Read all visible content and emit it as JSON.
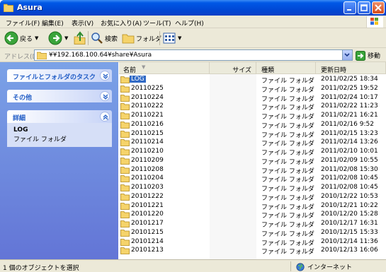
{
  "window": {
    "title": "Asura"
  },
  "menu": [
    "ファイル(F)",
    "編集(E)",
    "表示(V)",
    "お気に入り(A)",
    "ツール(T)",
    "ヘルプ(H)"
  ],
  "toolbar": {
    "back": "戻る",
    "search": "検索",
    "folders": "フォルダ"
  },
  "address": {
    "label": "アドレス(D)",
    "value": "¥¥192.168.100.64¥share¥Asura",
    "go": "移動"
  },
  "taskpane": {
    "file_tasks": "ファイルとフォルダのタスク",
    "other": "その他",
    "details": "詳細",
    "detail_name": "LOG",
    "detail_type": "ファイル フォルダ"
  },
  "columns": {
    "name": "名前",
    "size": "サイズ",
    "type": "種類",
    "date": "更新日時"
  },
  "files": [
    {
      "name": "LOG",
      "type": "ファイル フォルダ",
      "date": "2011/02/25 18:34",
      "selected": true
    },
    {
      "name": "20110225",
      "type": "ファイル フォルダ",
      "date": "2011/02/25 19:52"
    },
    {
      "name": "20110224",
      "type": "ファイル フォルダ",
      "date": "2011/02/24 10:17"
    },
    {
      "name": "20110222",
      "type": "ファイル フォルダ",
      "date": "2011/02/22 11:23"
    },
    {
      "name": "20110221",
      "type": "ファイル フォルダ",
      "date": "2011/02/21 16:21"
    },
    {
      "name": "20110216",
      "type": "ファイル フォルダ",
      "date": "2011/02/16 9:52"
    },
    {
      "name": "20110215",
      "type": "ファイル フォルダ",
      "date": "2011/02/15 13:23"
    },
    {
      "name": "20110214",
      "type": "ファイル フォルダ",
      "date": "2011/02/14 13:26"
    },
    {
      "name": "20110210",
      "type": "ファイル フォルダ",
      "date": "2011/02/10 10:01"
    },
    {
      "name": "20110209",
      "type": "ファイル フォルダ",
      "date": "2011/02/09 10:55"
    },
    {
      "name": "20110208",
      "type": "ファイル フォルダ",
      "date": "2011/02/08 15:30"
    },
    {
      "name": "20110204",
      "type": "ファイル フォルダ",
      "date": "2011/02/08 10:45"
    },
    {
      "name": "20110203",
      "type": "ファイル フォルダ",
      "date": "2011/02/08 10:45"
    },
    {
      "name": "20101222",
      "type": "ファイル フォルダ",
      "date": "2010/12/22 10:53"
    },
    {
      "name": "20101221",
      "type": "ファイル フォルダ",
      "date": "2010/12/21 10:22"
    },
    {
      "name": "20101220",
      "type": "ファイル フォルダ",
      "date": "2010/12/20 15:28"
    },
    {
      "name": "20101217",
      "type": "ファイル フォルダ",
      "date": "2010/12/17 16:31"
    },
    {
      "name": "20101215",
      "type": "ファイル フォルダ",
      "date": "2010/12/15 15:33"
    },
    {
      "name": "20101214",
      "type": "ファイル フォルダ",
      "date": "2010/12/14 11:36"
    },
    {
      "name": "20101213",
      "type": "ファイル フォルダ",
      "date": "2010/12/13 16:06"
    }
  ],
  "status": {
    "left": "1 個のオブジェクトを選択",
    "zone": "インターネット"
  },
  "colors": {
    "titlebar": "#0058e6",
    "taskpane": "#6b8ddf",
    "selection": "#316ac5",
    "folder": "#f5c542"
  }
}
